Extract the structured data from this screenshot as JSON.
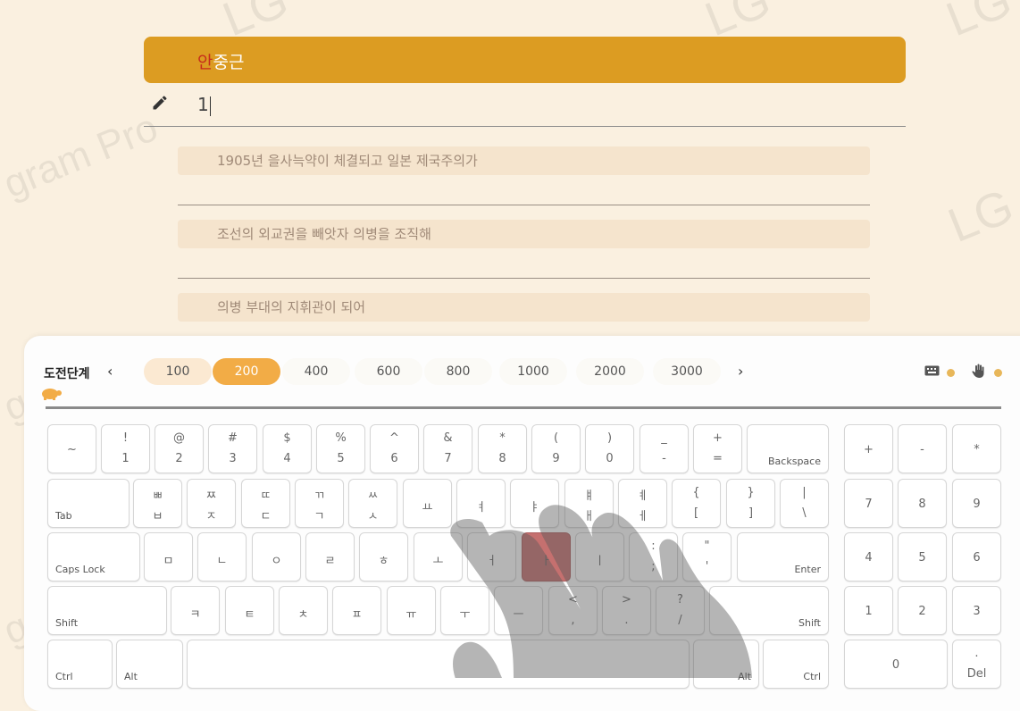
{
  "watermarks": [
    "LG",
    "LG",
    "LG",
    "gram Pro",
    "LG G",
    "gram Pro",
    "gram Pro"
  ],
  "sentence": {
    "title_first": "안",
    "title_rest": "중근",
    "typed_value": "1",
    "lines": [
      "1905년 을사늑약이 체결되고 일본 제국주의가",
      "조선의 외교권을 빼앗자 의병을 조직해",
      "의병 부대의 지휘관이 되어"
    ]
  },
  "keyboard": {
    "level_label": "도전단계",
    "levels": [
      "100",
      "200",
      "400",
      "600",
      "800",
      "1000",
      "2000",
      "3000"
    ],
    "active_level": "200",
    "prev_arrow": "‹",
    "next_arrow": "›",
    "colors": {
      "accent": "#f2ac46",
      "highlight": "#c5706f",
      "title_bg": "#dc9c22"
    },
    "icons": [
      "keyboard-icon",
      "hand-icon",
      "turtle-icon",
      "pencil-icon"
    ],
    "row1": [
      {
        "top": "",
        "bot": "~"
      },
      {
        "top": "!",
        "bot": "1"
      },
      {
        "top": "@",
        "bot": "2"
      },
      {
        "top": "#",
        "bot": "3"
      },
      {
        "top": "$",
        "bot": "4"
      },
      {
        "top": "%",
        "bot": "5"
      },
      {
        "top": "^",
        "bot": "6"
      },
      {
        "top": "&",
        "bot": "7"
      },
      {
        "top": "*",
        "bot": "8"
      },
      {
        "top": "(",
        "bot": "9"
      },
      {
        "top": ")",
        "bot": "0"
      },
      {
        "top": "_",
        "bot": "-"
      },
      {
        "top": "+",
        "bot": "="
      }
    ],
    "backspace": "Backspace",
    "tab": "Tab",
    "row2": [
      {
        "top": "ㅃ",
        "bot": "ㅂ"
      },
      {
        "top": "ㅉ",
        "bot": "ㅈ"
      },
      {
        "top": "ㄸ",
        "bot": "ㄷ"
      },
      {
        "top": "ㄲ",
        "bot": "ㄱ"
      },
      {
        "top": "ㅆ",
        "bot": "ㅅ"
      },
      {
        "top": "",
        "bot": "ㅛ"
      },
      {
        "top": "",
        "bot": "ㅕ"
      },
      {
        "top": "",
        "bot": "ㅑ"
      },
      {
        "top": "ㅒ",
        "bot": "ㅐ"
      },
      {
        "top": "ㅖ",
        "bot": "ㅔ"
      },
      {
        "top": "{",
        "bot": "["
      },
      {
        "top": "}",
        "bot": "]"
      },
      {
        "top": "|",
        "bot": "\\"
      }
    ],
    "caps": "Caps Lock",
    "row3": [
      {
        "top": "",
        "bot": "ㅁ"
      },
      {
        "top": "",
        "bot": "ㄴ"
      },
      {
        "top": "",
        "bot": "ㅇ"
      },
      {
        "top": "",
        "bot": "ㄹ"
      },
      {
        "top": "",
        "bot": "ㅎ"
      },
      {
        "top": "",
        "bot": "ㅗ"
      },
      {
        "top": "",
        "bot": "ㅓ"
      },
      {
        "top": "",
        "bot": "ㅏ"
      },
      {
        "top": "",
        "bot": "ㅣ"
      },
      {
        "top": ":",
        "bot": ";"
      },
      {
        "top": "\"",
        "bot": "'"
      }
    ],
    "enter": "Enter",
    "shift": "Shift",
    "row4": [
      {
        "top": "",
        "bot": "ㅋ"
      },
      {
        "top": "",
        "bot": "ㅌ"
      },
      {
        "top": "",
        "bot": "ㅊ"
      },
      {
        "top": "",
        "bot": "ㅍ"
      },
      {
        "top": "",
        "bot": "ㅠ"
      },
      {
        "top": "",
        "bot": "ㅜ"
      },
      {
        "top": "",
        "bot": "ㅡ"
      },
      {
        "top": "<",
        "bot": ","
      },
      {
        "top": ">",
        "bot": "."
      },
      {
        "top": "?",
        "bot": "/"
      }
    ],
    "ctrl": "Ctrl",
    "alt": "Alt",
    "numpad": [
      "+",
      "-",
      "*",
      "7",
      "8",
      "9",
      "4",
      "5",
      "6",
      "1",
      "2",
      "3",
      "0",
      "."
    ],
    "del": "Del"
  }
}
